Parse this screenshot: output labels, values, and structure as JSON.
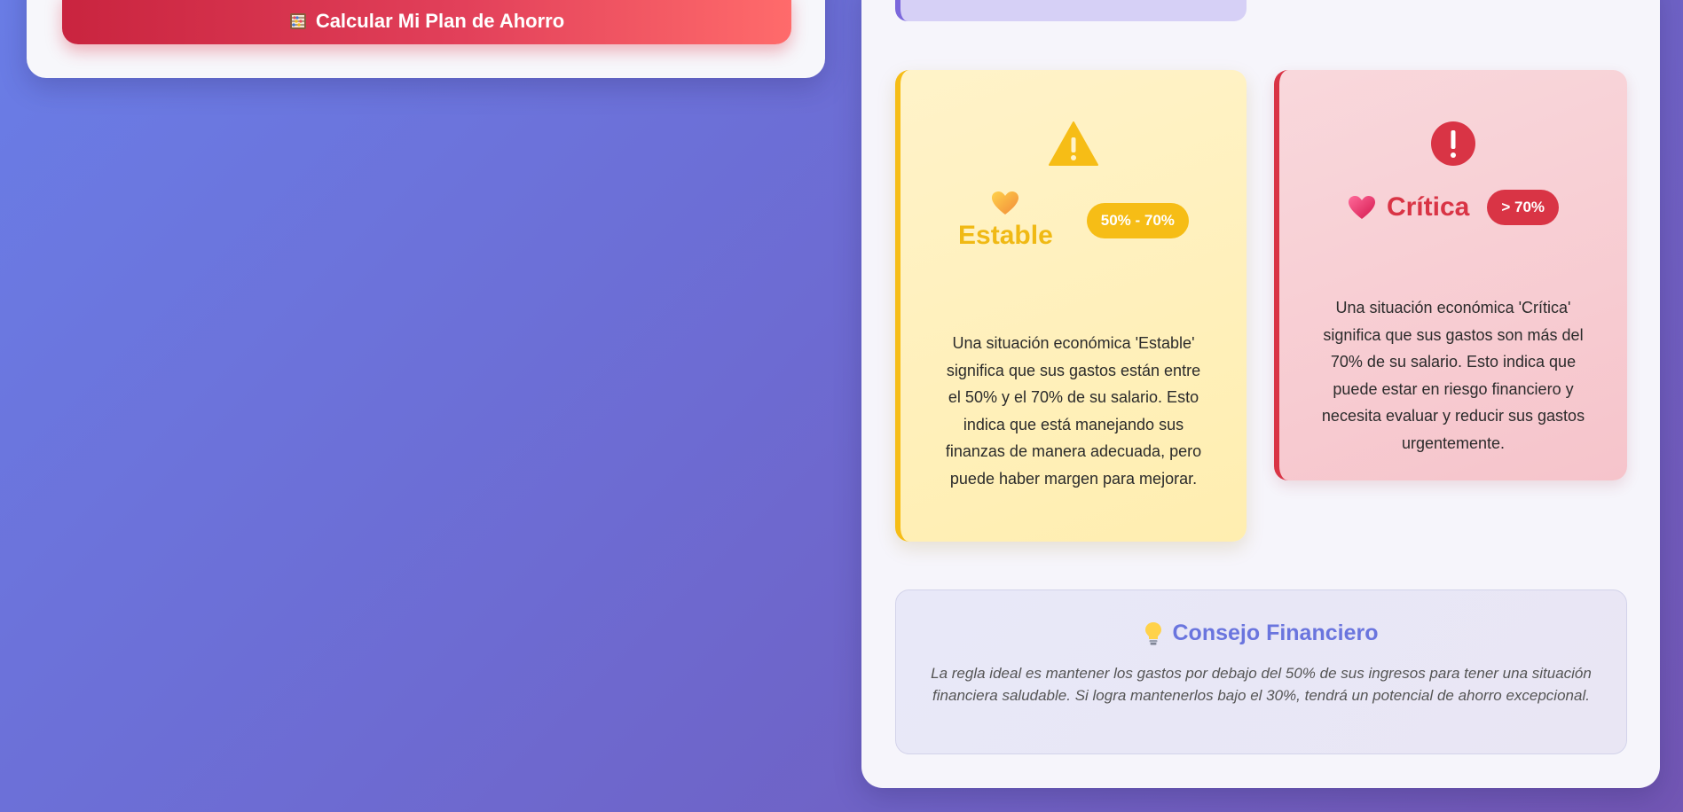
{
  "calculator": {
    "button_label": "Calcular Mi Plan de Ahorro",
    "button_icon": "abacus-icon"
  },
  "status_cards": {
    "estable": {
      "icon": "warning-triangle-icon",
      "heart_icon": "orange-heart-icon",
      "title": "Estable",
      "badge": "50% - 70%",
      "description": "Una situación económica 'Estable' significa que sus gastos están entre el 50% y el 70% de su salario. Esto indica que está manejando sus finanzas de manera adecuada, pero puede haber margen para mejorar.",
      "accent": "#f6bd16"
    },
    "critica": {
      "icon": "alert-circle-icon",
      "heart_icon": "red-heart-icon",
      "title": "Crítica",
      "badge": "> 70%",
      "description": "Una situación económica 'Crítica' significa que sus gastos son más del 70% de su salario. Esto indica que puede estar en riesgo financiero y necesita evaluar y reducir sus gastos urgentemente.",
      "accent": "#d93445"
    }
  },
  "advice": {
    "icon": "lightbulb-icon",
    "title": "Consejo Financiero",
    "text": "La regla ideal es mantener los gastos por debajo del 50% de sus ingresos para tener una situación financiera saludable. Si logra mantenerlos bajo el 30%, tendrá un potencial de ahorro excepcional.",
    "accent": "#6a75de"
  }
}
